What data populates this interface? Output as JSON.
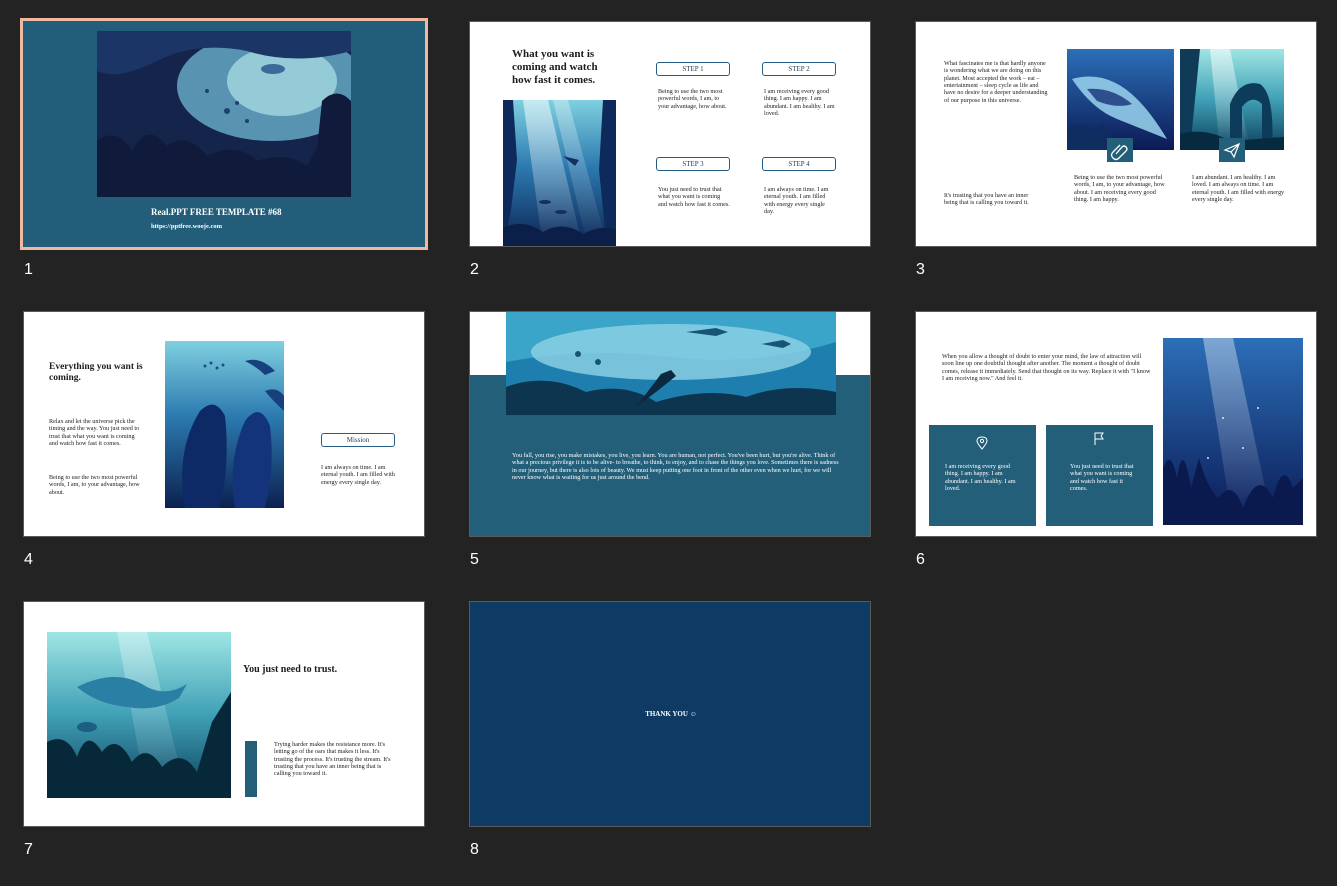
{
  "slides": [
    {
      "number": "1",
      "title": "Real.PPT FREE TEMPLATE #68",
      "url": "https://pptfree.wooje.com"
    },
    {
      "number": "2",
      "heading": "What you want is coming and watch how fast it comes.",
      "steps": [
        {
          "label": "STEP 1",
          "text": "Being to use the two most powerful words, I am, to your advantage, how about."
        },
        {
          "label": "STEP 2",
          "text": "I am receiving every good thing. I am happy. I am abundant. I am healthy. I am loved."
        },
        {
          "label": "STEP 3",
          "text": "You just need to trust that what you want is coming and watch how fast it comes."
        },
        {
          "label": "STEP 4",
          "text": "I am always on time. I am eternal youth. I am filled with energy every single day."
        }
      ]
    },
    {
      "number": "3",
      "intro": "What fascinates me is that hardly anyone is wondering what we are doing on this planet. Most accepted the work – eat – entertainment – sleep cycle as life and have no desire for a deeper understanding of our purpose in this universe.",
      "outro": "It's trusting that you have an inner being that is calling you toward it.",
      "card1": "Being to use the two most powerful words, I am, to your advantage, how about. I am receiving every good thing. I am happy.",
      "card2": "I am abundant. I am healthy. I am loved. I am always on time. I am eternal youth. I am filled with energy every single day."
    },
    {
      "number": "4",
      "heading": "Everything you want is coming.",
      "p1": "Relax and let the universe pick the timing and the way. You just need to trust that what you want is coming and watch how fast it comes.",
      "p2": "Being to use the two most powerful words, I am, to your advantage, how about.",
      "mission_label": "Mission",
      "mission_text": "I am always on time. I am eternal youth. I am filled with energy every single day."
    },
    {
      "number": "5",
      "body": "You fall, you rise, you make mistakes, you live, you learn. You are human, not perfect. You've been hurt, but you're alive. Think of what a precious privilege it is to be alive- to breathe, to think, to enjoy, and to chase the things you love. Sometimes there is sadness in our journey, but there is also lots of beauty. We must keep putting one foot in front of the other even when we hurt, for we will never know what is waiting for us just around the bend."
    },
    {
      "number": "6",
      "body": "When you allow a thought of doubt to enter your mind, the law of attraction will soon line up one doubtful thought after another. The moment a thought of doubt comes, release it immediately. Send that thought on its way. Replace it with \"I know I am receiving now.\" And feel it.",
      "card1": "I am receiving every good thing. I am happy. I am abundant. I am healthy. I am loved.",
      "card2": "You just need to trust that what you want is coming and watch how fast it comes."
    },
    {
      "number": "7",
      "heading": "You just need to trust.",
      "body": "Trying harder makes the resistance more. It's letting go of the oars that makes it less. It's trusting the process. It's trusting the stream. It's trusting that you have an inner being that is calling you toward it."
    },
    {
      "number": "8",
      "text": "THANK YOU ☺"
    }
  ],
  "icons": {
    "slide3_card1": "paperclip-icon",
    "slide3_card2": "paper-plane-icon",
    "slide6_card1": "location-pin-icon",
    "slide6_card2": "flag-icon"
  },
  "colors": {
    "background": "#232323",
    "teal": "#245f7a",
    "navy": "#0e3a63",
    "selected_border": "#f0b8a0"
  }
}
